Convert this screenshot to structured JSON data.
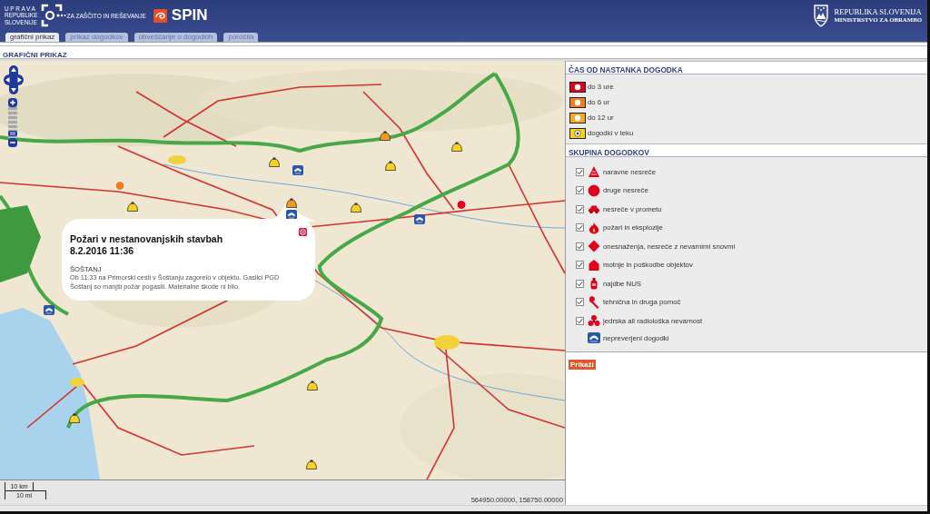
{
  "header": {
    "agency_lines": [
      "UPRAVA",
      "REPUBLIKE",
      "SLOVENIJE"
    ],
    "agency_subtitle": "ZA ZAŠČITO IN REŠEVANJE",
    "app_name": "SPIN",
    "ministry": {
      "country": "REPUBLIKA SLOVENIJA",
      "name": "MINISTRSTVO ZA OBRAMBO"
    }
  },
  "tabs": [
    {
      "label": "grafični prikaz",
      "selected": true
    },
    {
      "label": "prikaz dogodkov",
      "selected": false
    },
    {
      "label": "obveščanje o dogodkih",
      "selected": false
    },
    {
      "label": "poročila",
      "selected": false
    }
  ],
  "section_title": "GRAFIČNI PRIKAZ",
  "map": {
    "zoom": {
      "level": 0.08
    },
    "popup": {
      "title": "Požari v nestanovanjskih stavbah",
      "datetime": "8.2.2016 11:36",
      "place": "ŠOŠTANJ",
      "description": "Ob 11.33 na Primorski cesti v Šoštanju zagorelo v objektu. Gasilci PGD Šoštanj so manjši požar pogasili. Materialne škode ni bilo."
    },
    "scale": {
      "metric": "10 km",
      "imperial": "10 mi"
    },
    "coordinates": "564950.00000, 158750.00000"
  },
  "legend": {
    "time": {
      "title": "ČAS OD NASTANKA DOGODKA",
      "items": [
        {
          "label": "do 3 ure",
          "kind": "age",
          "color": "#e3001b"
        },
        {
          "label": "do 6 ur",
          "kind": "age",
          "color": "#f07d22"
        },
        {
          "label": "do 12 ur",
          "kind": "age",
          "color": "#f7a823"
        },
        {
          "label": "dogodki v teku",
          "kind": "ongoing",
          "color": "#f5d21e"
        }
      ]
    },
    "groups": {
      "title": "SKUPINA DOGODKOV",
      "items": [
        {
          "label": "naravne nesreče",
          "kind": "natural",
          "checked": true
        },
        {
          "label": "druge nesreče",
          "kind": "other",
          "checked": true
        },
        {
          "label": "nesreče v prometu",
          "kind": "traffic",
          "checked": true
        },
        {
          "label": "požari in eksplozije",
          "kind": "fire",
          "checked": true
        },
        {
          "label": "onesnaženja, nesreče z nevarnimi snovmi",
          "kind": "hazmat",
          "checked": true
        },
        {
          "label": "motnje in poškodbe objektov",
          "kind": "building",
          "checked": true
        },
        {
          "label": "najdbe NUS",
          "kind": "ordnance",
          "checked": true
        },
        {
          "label": "tehnična in druga pomoč",
          "kind": "technical",
          "checked": true
        },
        {
          "label": "jedrska ali radiološka nevarnost",
          "kind": "nuclear",
          "checked": true
        }
      ],
      "unverified": {
        "label": "nepreverjeni dogodki"
      }
    }
  },
  "show_button": "Prikaži"
}
